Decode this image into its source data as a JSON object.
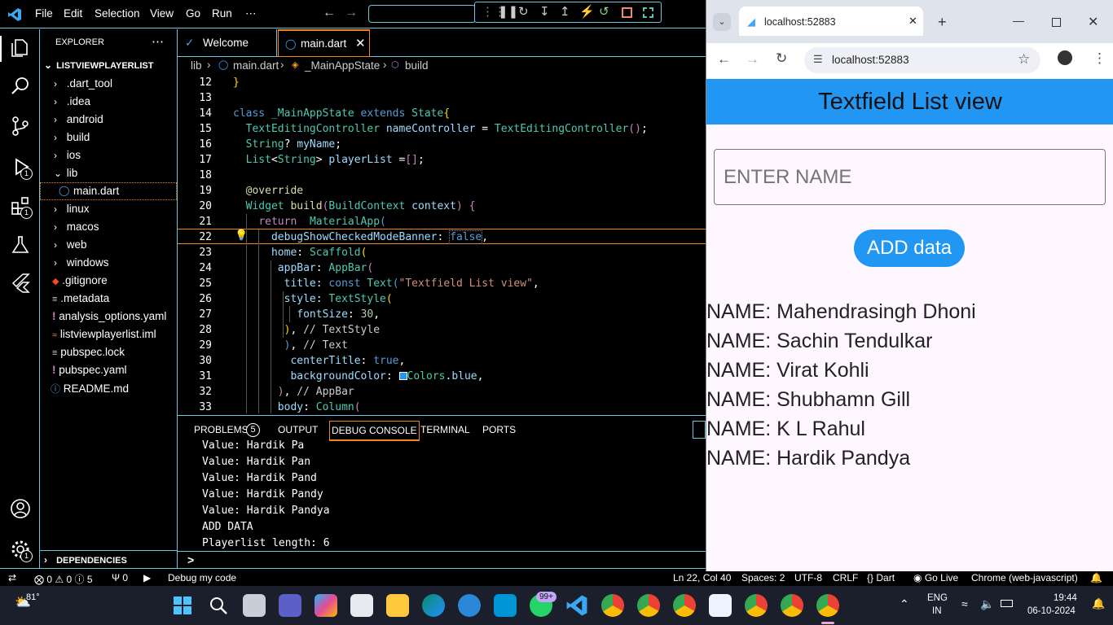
{
  "titlebar": {
    "menus": [
      "File",
      "Edit",
      "Selection",
      "View",
      "Go",
      "Run",
      "⋯"
    ]
  },
  "sidebar": {
    "title": "EXPLORER",
    "project": "LISTVIEWPLAYERLIST",
    "items": [
      {
        "label": ".dart_tool",
        "type": "folder"
      },
      {
        "label": ".idea",
        "type": "folder"
      },
      {
        "label": "android",
        "type": "folder"
      },
      {
        "label": "build",
        "type": "folder"
      },
      {
        "label": "ios",
        "type": "folder"
      },
      {
        "label": "lib",
        "type": "folder-open"
      },
      {
        "label": "main.dart",
        "type": "dart"
      },
      {
        "label": "linux",
        "type": "folder"
      },
      {
        "label": "macos",
        "type": "folder"
      },
      {
        "label": "web",
        "type": "folder"
      },
      {
        "label": "windows",
        "type": "folder"
      },
      {
        "label": ".gitignore",
        "type": "git"
      },
      {
        "label": ".metadata",
        "type": "file"
      },
      {
        "label": "analysis_options.yaml",
        "type": "yaml"
      },
      {
        "label": "listviewplayerlist.iml",
        "type": "rss"
      },
      {
        "label": "pubspec.lock",
        "type": "file"
      },
      {
        "label": "pubspec.yaml",
        "type": "yaml"
      },
      {
        "label": "README.md",
        "type": "info"
      }
    ],
    "dependencies": "DEPENDENCIES",
    "badges": {
      "run": "1",
      "extensions": "1",
      "settings": "1"
    }
  },
  "editor": {
    "tabs": [
      {
        "label": "Welcome"
      },
      {
        "label": "main.dart"
      }
    ],
    "breadcrumb": [
      "lib",
      "main.dart",
      "_MainAppState",
      "build"
    ],
    "line_numbers": [
      "12",
      "13",
      "14",
      "15",
      "16",
      "17",
      "18",
      "19",
      "20",
      "21",
      "22",
      "23",
      "24",
      "25",
      "26",
      "27",
      "28",
      "29",
      "30",
      "31",
      "32",
      "33"
    ]
  },
  "panel": {
    "tabs": [
      "PROBLEMS",
      "OUTPUT",
      "DEBUG CONSOLE",
      "TERMINAL",
      "PORTS"
    ],
    "problems_count": "5",
    "console_lines": [
      "Value: Hardik Pa",
      "Value: Hardik Pan",
      "Value: Hardik Pand",
      "Value: Hardik Pandy",
      "Value: Hardik Pandya",
      "ADD DATA",
      "Playerlist length: 6"
    ],
    "prompt": ">"
  },
  "status": {
    "errors": "0",
    "warnings": "0",
    "info": "5",
    "ports": "0",
    "debug": "Debug my code",
    "position": "Ln 22, Col 40",
    "spaces": "Spaces: 2",
    "encoding": "UTF-8",
    "eol": "CRLF",
    "language": "Dart",
    "golive": "Go Live",
    "device": "Chrome (web-javascript)"
  },
  "browser": {
    "tab_title": "localhost:52883",
    "url": "localhost:52883",
    "app_title": "Textfield List view",
    "input_placeholder": "ENTER NAME",
    "button_label": "ADD data",
    "players": [
      "NAME: Mahendrasingh Dhoni",
      "NAME: Sachin Tendulkar",
      "NAME: Virat Kohli",
      "NAME: Shubhamn Gill",
      "NAME: K L Rahul",
      "NAME: Hardik Pandya"
    ]
  },
  "taskbar": {
    "weather": "81°",
    "lang1": "ENG",
    "lang2": "IN",
    "time": "19:44",
    "date": "06-10-2024",
    "notif_badge": "99+"
  },
  "colors": {
    "accent": "#6fc3df",
    "flutter_blue": "#2196f3"
  }
}
